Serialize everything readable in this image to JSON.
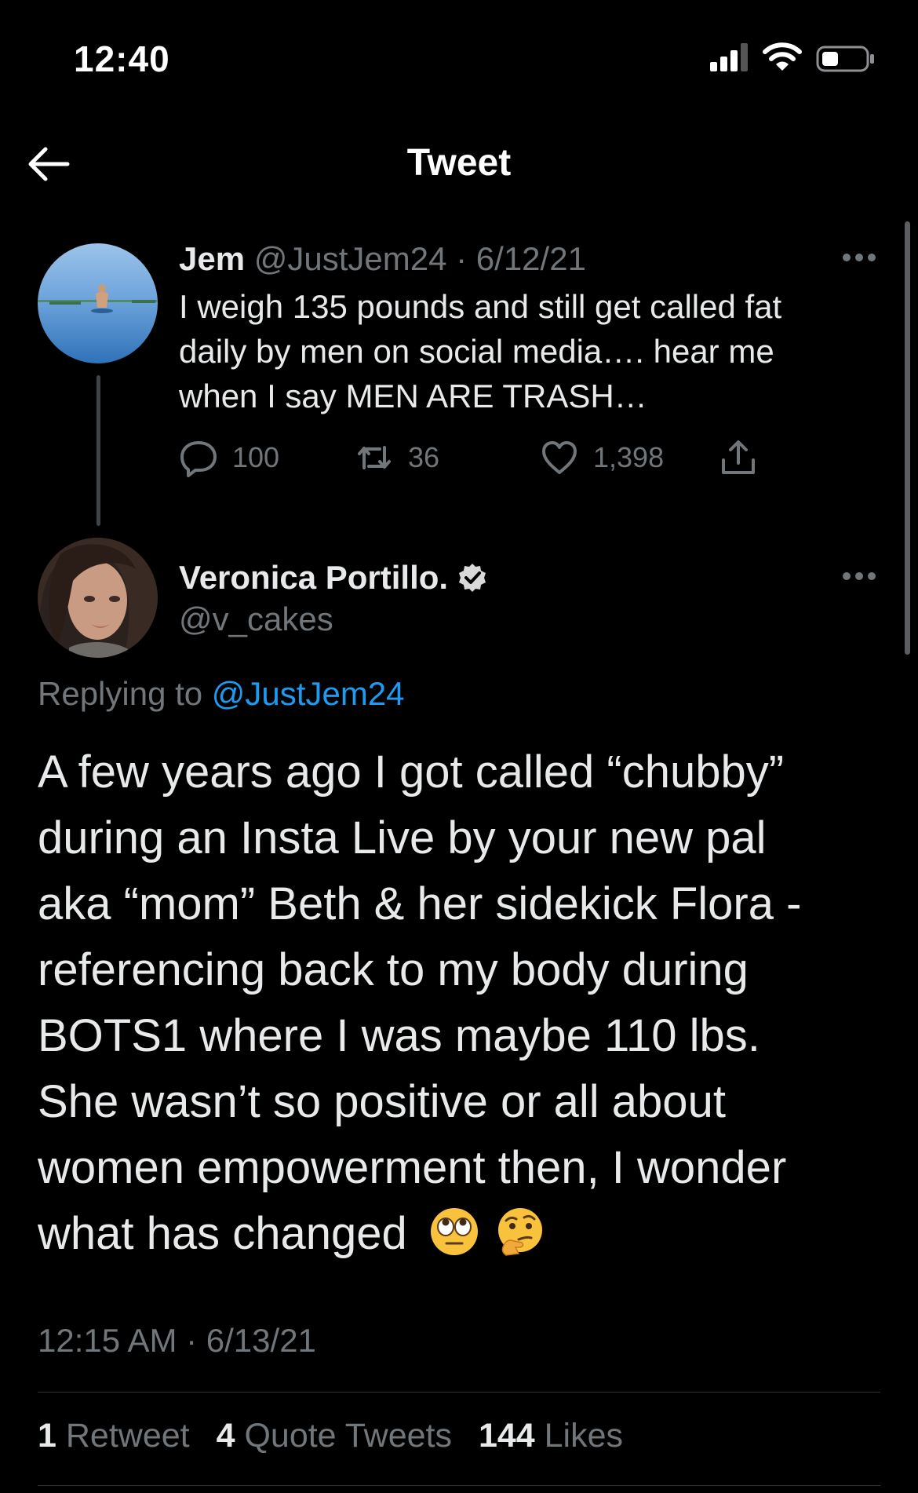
{
  "status_bar": {
    "time": "12:40"
  },
  "header": {
    "title": "Tweet"
  },
  "parent_tweet": {
    "name": "Jem",
    "handle": "@JustJem24",
    "date": "· 6/12/21",
    "lines": [
      "I weigh 135 pounds and still get called fat",
      "daily by men on social media…. hear me",
      "when I say MEN ARE TRASH…"
    ],
    "replies": "100",
    "retweets": "36",
    "likes": "1,398"
  },
  "main_tweet": {
    "name": "Veronica Portillo.",
    "handle": "@v_cakes",
    "replying_prefix": "Replying to",
    "replying_to": "@JustJem24",
    "lines": [
      "A few years ago I got called “chubby”",
      "during an Insta Live by your new pal",
      "aka “mom” Beth & her sidekick Flora -",
      "referencing back to my body during",
      "BOTS1 where I was maybe 110 lbs.",
      "She wasn’t so positive or all about",
      "women empowerment then, I wonder",
      "what has changed"
    ],
    "emojis": [
      "eye-roll-emoji",
      "thinking-emoji"
    ],
    "timestamp": "12:15 AM · 6/13/21",
    "stats": {
      "retweets_count": "1",
      "retweets_label": "Retweet",
      "quotes_count": "4",
      "quotes_label": "Quote Tweets",
      "likes_count": "144",
      "likes_label": "Likes"
    }
  },
  "colors": {
    "background": "#000000",
    "text": "#e7e9ea",
    "muted": "#71767b",
    "link": "#1d9bf0"
  }
}
